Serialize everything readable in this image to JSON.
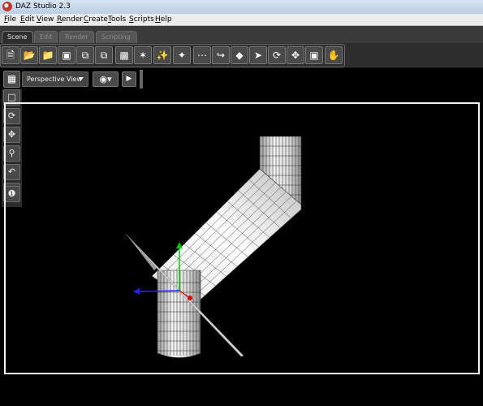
{
  "window": {
    "title": "DAZ Studio 2.3"
  },
  "menu": [
    "File",
    "Edit",
    "View",
    "Render",
    "Create",
    "Tools",
    "Scripts",
    "Help"
  ],
  "tabs": [
    {
      "label": "Scene",
      "active": true
    },
    {
      "label": "Edit",
      "active": false
    },
    {
      "label": "Render",
      "active": false
    },
    {
      "label": "Scripting",
      "active": false
    }
  ],
  "toolbar_icons": [
    "new-file-icon",
    "open-file-icon",
    "merge-file-icon",
    "save-icon",
    "import-icon",
    "export-icon",
    "new-camera-icon",
    "new-spotlight-icon",
    "new-point-light-icon",
    "new-distant-light-icon",
    "new-primitive-icon",
    "parent-icon",
    "unparent-icon",
    "select-icon",
    "rotate-icon",
    "translate-icon",
    "scale-icon",
    "pose-icon"
  ],
  "viewport": {
    "view_name": "Perspective View"
  },
  "left_tools": [
    "frame-icon",
    "orbit-icon",
    "pan-icon",
    "zoom-icon",
    "bank-icon",
    "dolly-icon",
    "view-menu-icon"
  ],
  "colors": {
    "axis_x": "#2222ff",
    "axis_y": "#00cc00",
    "axis_z": "#dd0000",
    "background": "#000000"
  }
}
